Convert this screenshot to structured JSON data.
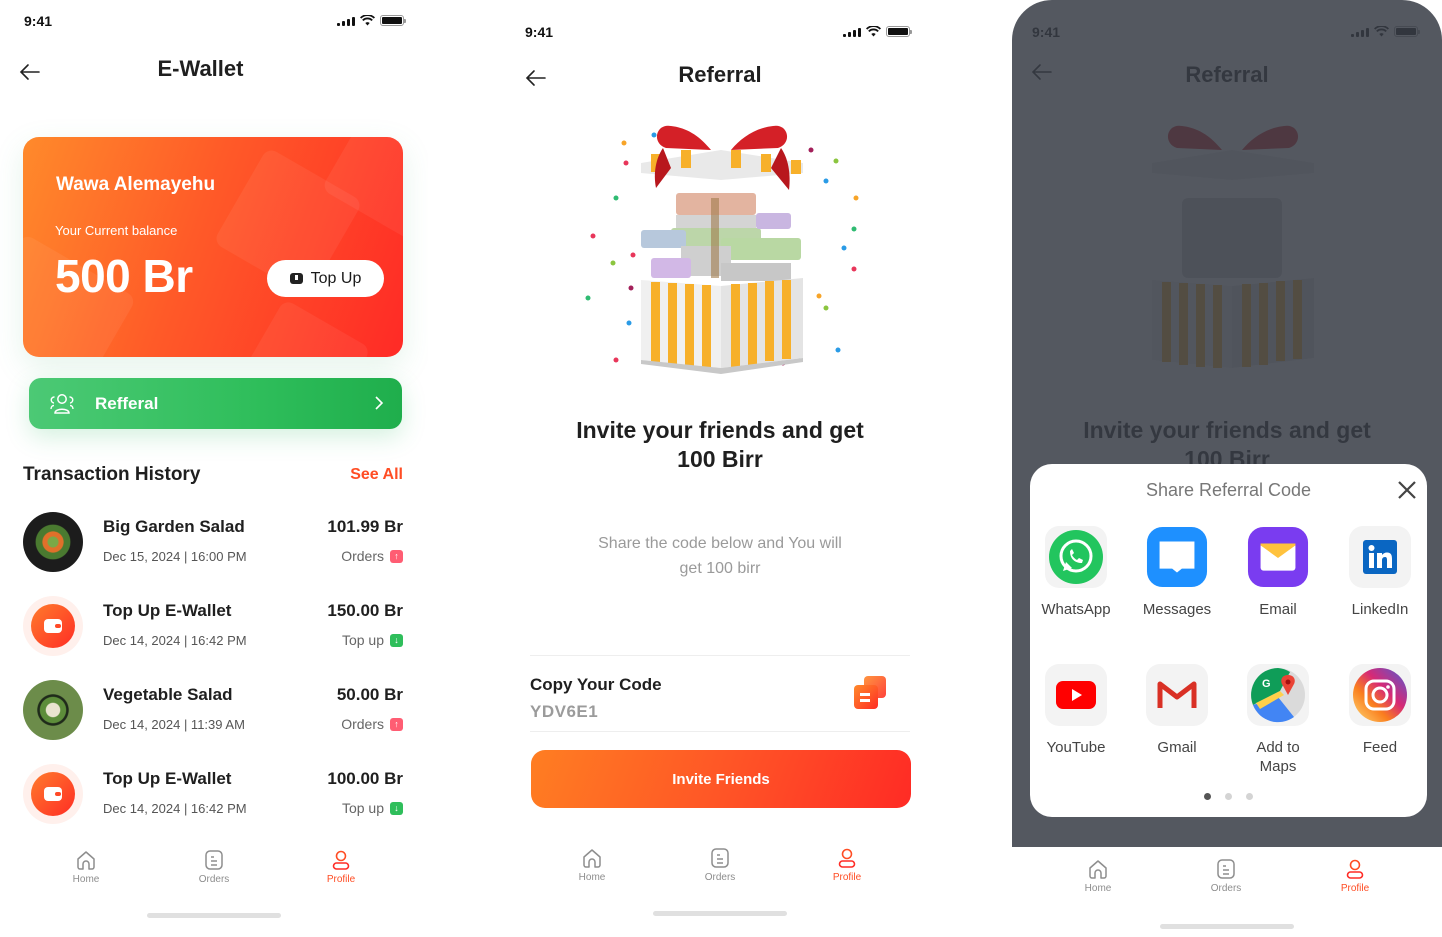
{
  "status_bar": {
    "time": "9:41"
  },
  "ewallet": {
    "title": "E-Wallet",
    "card": {
      "holder_name": "Wawa Alemayehu",
      "balance_label": "Your Current balance",
      "balance": "500 Br",
      "topup_label": "Top Up"
    },
    "referral_label": "Refferal",
    "history": {
      "title": "Transaction History",
      "see_all": "See All",
      "items": [
        {
          "title": "Big Garden Salad",
          "date": "Dec 15, 2024 | 16:00 PM",
          "amount": "101.99 Br",
          "type": "Orders",
          "direction": "up",
          "icon": "salad-photo"
        },
        {
          "title": "Top Up E-Wallet",
          "date": "Dec 14, 2024 | 16:42 PM",
          "amount": "150.00 Br",
          "type": "Top up",
          "direction": "down",
          "icon": "wallet-icon"
        },
        {
          "title": "Vegetable Salad",
          "date": "Dec 14, 2024 | 11:39 AM",
          "amount": "50.00 Br",
          "type": "Orders",
          "direction": "up",
          "icon": "salad-photo"
        },
        {
          "title": "Top Up E-Wallet",
          "date": "Dec 14, 2024 | 16:42 PM",
          "amount": "100.00 Br",
          "type": "Top up",
          "direction": "down",
          "icon": "wallet-icon"
        }
      ]
    }
  },
  "referral": {
    "title": "Referral",
    "headline_line1": "Invite your friends and get",
    "headline_line2": "100 Birr",
    "subtext_line1": "Share the code below and You will",
    "subtext_line2": "get 100 birr",
    "code_label": "Copy Your Code",
    "code_value": "YDV6E1",
    "invite_button": "Invite Friends"
  },
  "share_sheet": {
    "title": "Share Referral Code",
    "apps": [
      {
        "label": "WhatsApp",
        "icon": "whatsapp-icon"
      },
      {
        "label": "Messages",
        "icon": "messages-icon"
      },
      {
        "label": "Email",
        "icon": "email-icon"
      },
      {
        "label": "LinkedIn",
        "icon": "linkedin-icon"
      },
      {
        "label": "YouTube",
        "icon": "youtube-icon"
      },
      {
        "label": "Gmail",
        "icon": "gmail-icon"
      },
      {
        "label": "Add to Maps",
        "icon": "maps-icon"
      },
      {
        "label": "Feed",
        "icon": "instagram-icon"
      }
    ],
    "page_count": 3,
    "active_page": 1
  },
  "tabbar": {
    "items": [
      {
        "label": "Home",
        "icon": "home-icon"
      },
      {
        "label": "Orders",
        "icon": "orders-icon"
      },
      {
        "label": "Profile",
        "icon": "profile-icon",
        "active": true
      }
    ]
  },
  "colors": {
    "accent": "#ff4d24",
    "success": "#2fbe5b",
    "debit_badge": "#ff5d73"
  }
}
